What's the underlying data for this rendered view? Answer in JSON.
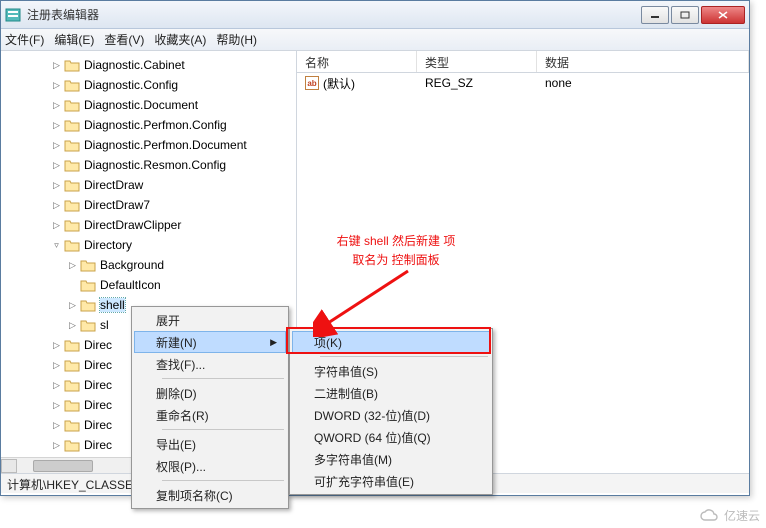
{
  "window": {
    "title": "注册表编辑器"
  },
  "menu": [
    "文件(F)",
    "编辑(E)",
    "查看(V)",
    "收藏夹(A)",
    "帮助(H)"
  ],
  "tree": [
    {
      "depth": 3,
      "tw": "▷",
      "label": "Diagnostic.Cabinet"
    },
    {
      "depth": 3,
      "tw": "▷",
      "label": "Diagnostic.Config"
    },
    {
      "depth": 3,
      "tw": "▷",
      "label": "Diagnostic.Document"
    },
    {
      "depth": 3,
      "tw": "▷",
      "label": "Diagnostic.Perfmon.Config"
    },
    {
      "depth": 3,
      "tw": "▷",
      "label": "Diagnostic.Perfmon.Document"
    },
    {
      "depth": 3,
      "tw": "▷",
      "label": "Diagnostic.Resmon.Config"
    },
    {
      "depth": 3,
      "tw": "▷",
      "label": "DirectDraw"
    },
    {
      "depth": 3,
      "tw": "▷",
      "label": "DirectDraw7"
    },
    {
      "depth": 3,
      "tw": "▷",
      "label": "DirectDrawClipper"
    },
    {
      "depth": 3,
      "tw": "▿",
      "label": "Directory"
    },
    {
      "depth": 4,
      "tw": "▷",
      "label": "Background"
    },
    {
      "depth": 4,
      "tw": "",
      "label": "DefaultIcon"
    },
    {
      "depth": 4,
      "tw": "▷",
      "label": "shell",
      "sel": true
    },
    {
      "depth": 4,
      "tw": "▷",
      "label": "sl"
    },
    {
      "depth": 3,
      "tw": "▷",
      "label": "Direc"
    },
    {
      "depth": 3,
      "tw": "▷",
      "label": "Direc"
    },
    {
      "depth": 3,
      "tw": "▷",
      "label": "Direc"
    },
    {
      "depth": 3,
      "tw": "▷",
      "label": "Direc"
    },
    {
      "depth": 3,
      "tw": "▷",
      "label": "Direc"
    },
    {
      "depth": 3,
      "tw": "▷",
      "label": "Direc"
    },
    {
      "depth": 3,
      "tw": "▷",
      "label": "Direc"
    }
  ],
  "columns": {
    "name": "名称",
    "type": "类型",
    "data": "数据"
  },
  "rows": [
    {
      "name": "(默认)",
      "type": "REG_SZ",
      "data": "none"
    }
  ],
  "ctx1": [
    {
      "label": "展开",
      "sep": false
    },
    {
      "label": "新建(N)",
      "sub": true,
      "hov": true
    },
    {
      "label": "查找(F)...",
      "sep_after": true
    },
    {
      "label": "删除(D)"
    },
    {
      "label": "重命名(R)",
      "sep_after": true
    },
    {
      "label": "导出(E)"
    },
    {
      "label": "权限(P)...",
      "sep_after": true
    },
    {
      "label": "复制项名称(C)"
    }
  ],
  "ctx2": [
    {
      "label": "项(K)",
      "hov": true,
      "sep_after": true
    },
    {
      "label": "字符串值(S)"
    },
    {
      "label": "二进制值(B)"
    },
    {
      "label": "DWORD (32-位)值(D)"
    },
    {
      "label": "QWORD (64 位)值(Q)"
    },
    {
      "label": "多字符串值(M)"
    },
    {
      "label": "可扩充字符串值(E)"
    }
  ],
  "annot": {
    "line1": "右键 shell 然后新建 项",
    "line2": "取名为 控制面板"
  },
  "status": "计算机\\HKEY_CLASSES_ROOT\\Directory\\shell",
  "logo": "亿速云"
}
